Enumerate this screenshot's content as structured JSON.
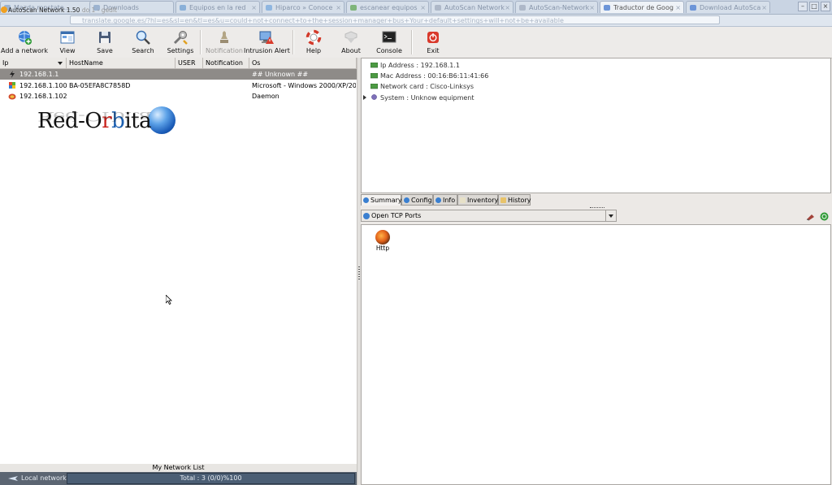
{
  "browser": {
    "tabs": [
      {
        "label": "Mazda mpstate...",
        "active": false
      },
      {
        "label": "Downloads",
        "active": false
      },
      {
        "label": "Equipos en la red",
        "active": false
      },
      {
        "label": "Hiparco » Conoce",
        "active": false
      },
      {
        "label": "escanear equipos",
        "active": false
      },
      {
        "label": "AutoScan Network",
        "active": false
      },
      {
        "label": "AutoScan-Network",
        "active": false
      },
      {
        "label": "Traductor de Goog",
        "active": true
      },
      {
        "label": "Download AutoSca",
        "active": false
      }
    ],
    "url": "translate.google.es/?hl=es&sl=en&tl=es&u=could+not+connect+to+the+session+manager+bus+Your+default+settings+will+not+be+available"
  },
  "window_title": "AutoScan Network 1.50",
  "window_title_suffix": "do 1 - gedit",
  "toolbar": {
    "buttons": [
      {
        "label": "Add a network",
        "enabled": true,
        "icon": "globe-add-icon"
      },
      {
        "label": "View",
        "enabled": true,
        "icon": "view-icon"
      },
      {
        "label": "Save",
        "enabled": true,
        "icon": "save-icon"
      },
      {
        "label": "Search",
        "enabled": true,
        "icon": "search-icon"
      },
      {
        "label": "Settings",
        "enabled": true,
        "icon": "settings-icon"
      },
      {
        "label": "Notification",
        "enabled": false,
        "icon": "notification-icon"
      },
      {
        "label": "Intrusion Alert",
        "enabled": true,
        "icon": "intrusion-alert-icon"
      },
      {
        "label": "Help",
        "enabled": true,
        "icon": "help-icon"
      },
      {
        "label": "About",
        "enabled": true,
        "icon": "about-icon"
      },
      {
        "label": "Console",
        "enabled": true,
        "icon": "console-icon"
      },
      {
        "label": "Exit",
        "enabled": true,
        "icon": "exit-icon"
      }
    ]
  },
  "network_list": {
    "columns": [
      "Ip",
      "HostName",
      "USER",
      "Notification",
      "Os"
    ],
    "rows": [
      {
        "ip": "192.168.1.1",
        "hostname": "",
        "user": "",
        "notification": "",
        "os": "## Unknown ##",
        "selected": true,
        "icon": "router-icon"
      },
      {
        "ip": "192.168.1.100",
        "hostname": "BA-05EFA8C7858D",
        "user": "",
        "notification": "",
        "os": "Microsoft - Windows 2000/XP/2003",
        "selected": false,
        "icon": "windows-icon"
      },
      {
        "ip": "192.168.1.102",
        "hostname": "",
        "user": "",
        "notification": "",
        "os": "Daemon",
        "selected": false,
        "icon": "daemon-icon"
      }
    ],
    "logo_text": "Red-Orbita",
    "title": "My Network List",
    "status": {
      "local_network": "Local network",
      "total": "Total : 3  (0/0)%100"
    }
  },
  "details": {
    "items": [
      {
        "label": "Ip Address : 192.168.1.1",
        "icon": "network-icon"
      },
      {
        "label": "Mac Address : 00:16:B6:11:41:66",
        "icon": "network-icon"
      },
      {
        "label": "Network card : Cisco-Linksys",
        "icon": "network-icon"
      },
      {
        "label": "System : Unknow equipment",
        "icon": "system-icon",
        "expandable": true
      }
    ],
    "tabs": [
      {
        "label": "Summary",
        "active": true
      },
      {
        "label": "Config",
        "active": false
      },
      {
        "label": "Info",
        "active": false
      },
      {
        "label": "Inventory",
        "active": false
      },
      {
        "label": "History",
        "active": false
      }
    ],
    "ports_select": "Open TCP Ports",
    "ports": [
      {
        "label": "Http",
        "icon": "http-port-icon"
      }
    ]
  },
  "colors": {
    "selected_row": "#8e8b88",
    "status_bar": "#5b6572",
    "total_box": "#4b5e74"
  }
}
